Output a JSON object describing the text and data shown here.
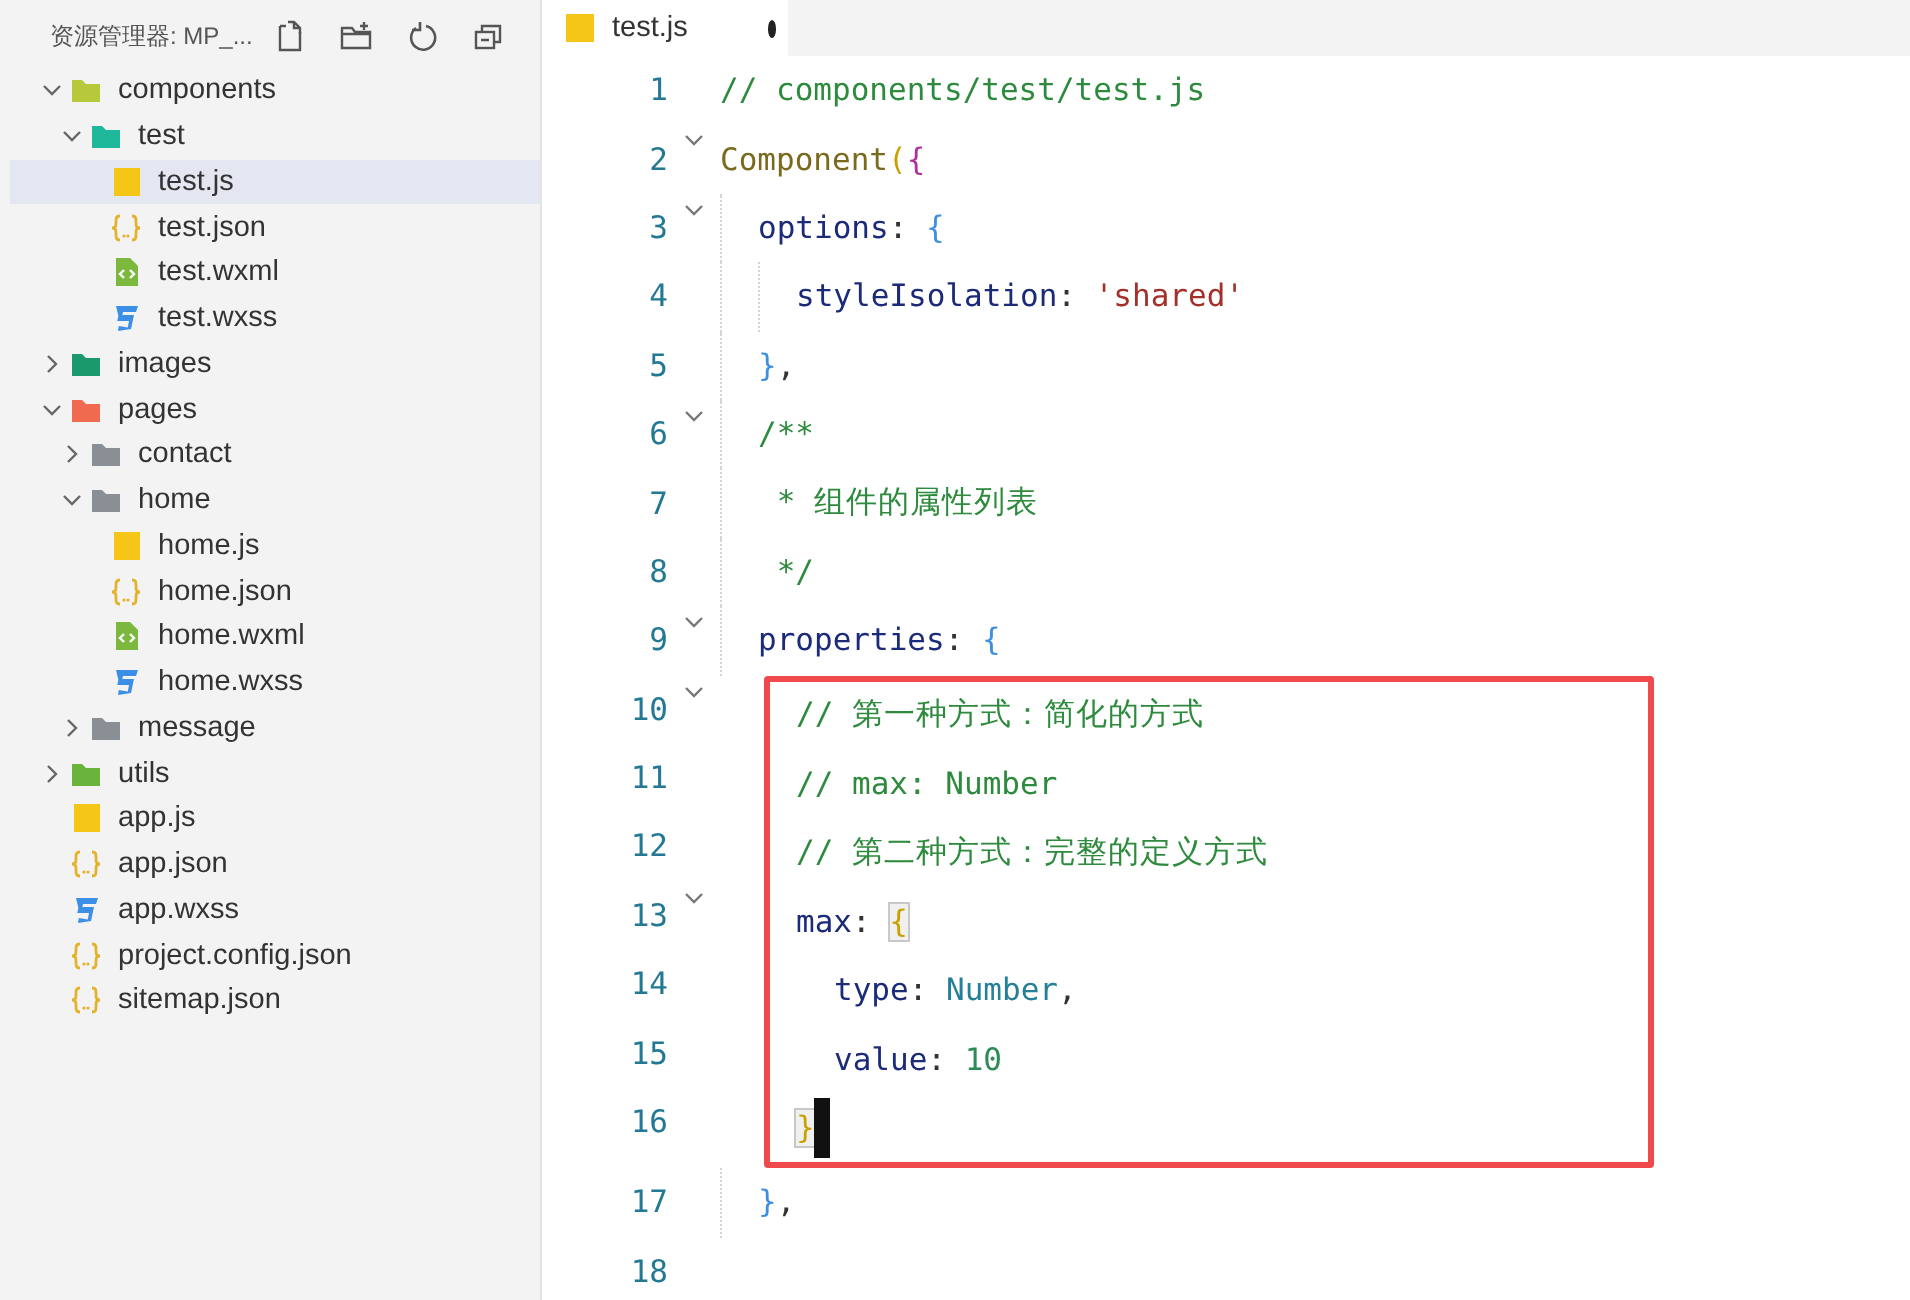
{
  "explorer": {
    "title": "资源管理器: MP_...",
    "tree": [
      {
        "label": "components",
        "kind": "folder",
        "color": "#b5c93a",
        "expanded": true,
        "selected": false,
        "children": [
          {
            "label": "test",
            "kind": "folder",
            "color": "#1fb89a",
            "expanded": true,
            "selected": false,
            "children": [
              {
                "label": "test.js",
                "kind": "js",
                "selected": true
              },
              {
                "label": "test.json",
                "kind": "json",
                "selected": false
              },
              {
                "label": "test.wxml",
                "kind": "wxml",
                "selected": false
              },
              {
                "label": "test.wxss",
                "kind": "wxss",
                "selected": false
              }
            ]
          }
        ]
      },
      {
        "label": "images",
        "kind": "folder",
        "color": "#1a9a6c",
        "expanded": false,
        "selected": false
      },
      {
        "label": "pages",
        "kind": "folder",
        "color": "#ef6a4f",
        "expanded": true,
        "selected": false,
        "children": [
          {
            "label": "contact",
            "kind": "folder",
            "color": "#8a8f96",
            "expanded": false,
            "selected": false
          },
          {
            "label": "home",
            "kind": "folder",
            "color": "#8a8f96",
            "expanded": true,
            "selected": false,
            "children": [
              {
                "label": "home.js",
                "kind": "js",
                "selected": false
              },
              {
                "label": "home.json",
                "kind": "json",
                "selected": false
              },
              {
                "label": "home.wxml",
                "kind": "wxml",
                "selected": false
              },
              {
                "label": "home.wxss",
                "kind": "wxss",
                "selected": false
              }
            ]
          },
          {
            "label": "message",
            "kind": "folder",
            "color": "#8a8f96",
            "expanded": false,
            "selected": false
          }
        ]
      },
      {
        "label": "utils",
        "kind": "folder",
        "color": "#6ab43c",
        "expanded": false,
        "selected": false
      },
      {
        "label": "app.js",
        "kind": "js",
        "selected": false
      },
      {
        "label": "app.json",
        "kind": "json",
        "selected": false
      },
      {
        "label": "app.wxss",
        "kind": "wxss",
        "selected": false
      },
      {
        "label": "project.config.json",
        "kind": "json",
        "selected": false
      },
      {
        "label": "sitemap.json",
        "kind": "json",
        "selected": false
      }
    ]
  },
  "tab": {
    "label": "test.js",
    "modified": true,
    "selected": true
  },
  "lines": [
    {
      "number": "1",
      "foldable": false,
      "highlighted": false,
      "current": false,
      "tokens": [
        {
          "text": "// components/test/test.js",
          "kind": "comment"
        }
      ]
    },
    {
      "number": "2",
      "foldable": true,
      "highlighted": false,
      "current": false,
      "tokens": [
        {
          "text": "Component",
          "kind": "func"
        },
        {
          "text": "(",
          "kind": "bracket1"
        },
        {
          "text": "{",
          "kind": "bracket2"
        }
      ],
      "children": [
        {
          "number": "3",
          "foldable": true,
          "highlighted": false,
          "current": false,
          "tokens": [
            {
              "text": "options",
              "kind": "prop"
            },
            {
              "text": ": ",
              "kind": "punct"
            },
            {
              "text": "{",
              "kind": "bracket3"
            }
          ],
          "children": [
            {
              "number": "4",
              "foldable": false,
              "highlighted": false,
              "current": false,
              "tokens": [
                {
                  "text": "styleIsolation",
                  "kind": "prop"
                },
                {
                  "text": ": ",
                  "kind": "punct"
                },
                {
                  "text": "'shared'",
                  "kind": "string"
                }
              ]
            }
          ]
        },
        {
          "number": "5",
          "foldable": false,
          "highlighted": false,
          "current": false,
          "tokens": [
            {
              "text": "}",
              "kind": "bracket3"
            },
            {
              "text": ",",
              "kind": "punct"
            }
          ]
        },
        {
          "number": "6",
          "foldable": true,
          "highlighted": false,
          "current": false,
          "tokens": [
            {
              "text": "/**",
              "kind": "comment"
            }
          ]
        },
        {
          "number": "7",
          "foldable": false,
          "highlighted": false,
          "current": false,
          "tokens": [
            {
              "text": " * 组件的属性列表",
              "kind": "comment"
            }
          ]
        },
        {
          "number": "8",
          "foldable": false,
          "highlighted": false,
          "current": false,
          "tokens": [
            {
              "text": " */",
              "kind": "comment"
            }
          ]
        },
        {
          "number": "9",
          "foldable": true,
          "highlighted": false,
          "current": false,
          "tokens": [
            {
              "text": "properties",
              "kind": "prop"
            },
            {
              "text": ": ",
              "kind": "punct"
            },
            {
              "text": "{",
              "kind": "bracket3"
            }
          ],
          "children": [
            {
              "number": "10",
              "foldable": true,
              "highlighted": true,
              "current": false,
              "tokens": [
                {
                  "text": "// 第一种方式：简化的方式",
                  "kind": "comment"
                }
              ]
            },
            {
              "number": "11",
              "foldable": false,
              "highlighted": true,
              "current": false,
              "tokens": [
                {
                  "text": "// max: Number",
                  "kind": "comment"
                }
              ]
            },
            {
              "number": "12",
              "foldable": false,
              "highlighted": true,
              "current": false,
              "tokens": [
                {
                  "text": "// 第二种方式：完整的定义方式",
                  "kind": "comment"
                }
              ]
            },
            {
              "number": "13",
              "foldable": true,
              "highlighted": true,
              "current": false,
              "tokens": [
                {
                  "text": "max",
                  "kind": "prop"
                },
                {
                  "text": ": ",
                  "kind": "punct"
                },
                {
                  "text": "{",
                  "kind": "bracket_matched"
                }
              ],
              "children": [
                {
                  "number": "14",
                  "foldable": false,
                  "highlighted": true,
                  "current": false,
                  "tokens": [
                    {
                      "text": "type",
                      "kind": "prop"
                    },
                    {
                      "text": ": ",
                      "kind": "punct"
                    },
                    {
                      "text": "Number",
                      "kind": "type"
                    },
                    {
                      "text": ",",
                      "kind": "punct"
                    }
                  ]
                },
                {
                  "number": "15",
                  "foldable": false,
                  "highlighted": true,
                  "current": false,
                  "tokens": [
                    {
                      "text": "value",
                      "kind": "prop"
                    },
                    {
                      "text": ": ",
                      "kind": "punct"
                    },
                    {
                      "text": "10",
                      "kind": "number"
                    }
                  ]
                }
              ]
            },
            {
              "number": "16",
              "foldable": false,
              "highlighted": true,
              "current": true,
              "tokens": [
                {
                  "text": "}",
                  "kind": "bracket_matched"
                }
              ]
            }
          ]
        },
        {
          "number": "17",
          "foldable": false,
          "highlighted": false,
          "current": false,
          "tokens": [
            {
              "text": "}",
              "kind": "bracket3"
            },
            {
              "text": ",",
              "kind": "punct"
            }
          ]
        }
      ]
    },
    {
      "number": "18",
      "foldable": false,
      "highlighted": false,
      "current": false
    }
  ]
}
